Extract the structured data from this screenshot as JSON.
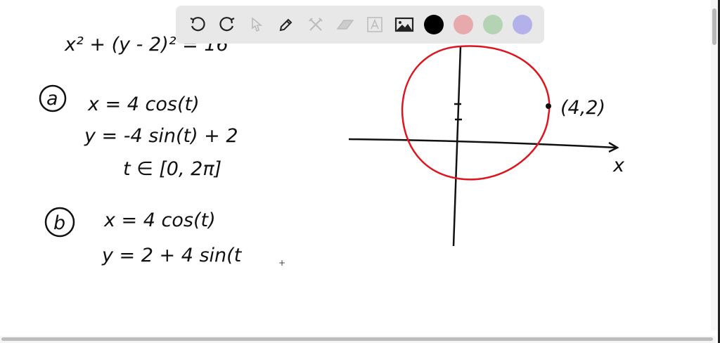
{
  "toolbar": {
    "tools": [
      "undo-icon",
      "redo-icon",
      "select-icon",
      "pen-icon",
      "tools-icon",
      "eraser-icon",
      "text-icon",
      "image-icon"
    ],
    "colors": [
      "#000000",
      "#e8a9ad",
      "#b4d3b2",
      "#b3b1ea"
    ]
  },
  "board": {
    "equation": "x² + (y - 2)² = 16",
    "part_a": {
      "label": "a",
      "x_eq": "x = 4 cos(t)",
      "y_eq": "y = -4 sin(t) + 2",
      "domain": "t ∈ [0, 2π]"
    },
    "part_b": {
      "label": "b",
      "x_eq": "x = 4 cos(t)",
      "y_eq": "y = 2 + 4 sin(t"
    },
    "graph": {
      "point_label": "(4,2)",
      "x_axis_label": "x",
      "circle_color": "#e0141e"
    }
  }
}
